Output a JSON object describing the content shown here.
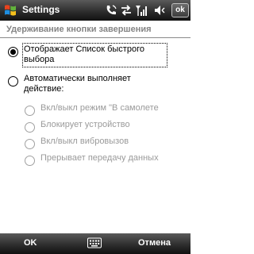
{
  "titlebar": {
    "title": "Settings",
    "ok_label": "ok",
    "icons": [
      "windows-start-icon",
      "phone-signal-icon",
      "sync-arrows-icon",
      "signal-strength-icon",
      "speaker-icon"
    ]
  },
  "page": {
    "heading": "Удерживание кнопки завершения"
  },
  "options": [
    {
      "label_line1": "Отображает Список быстрого",
      "label_line2": "выбора",
      "selected": true,
      "enabled": true
    },
    {
      "label_line1": "Автоматически выполняет",
      "label_line2": "действие:",
      "selected": false,
      "enabled": true
    },
    {
      "label": "Вкл/выкл режим \"В самолете",
      "selected": false,
      "enabled": false
    },
    {
      "label": "Блокирует устройство",
      "selected": false,
      "enabled": false
    },
    {
      "label": "Вкл/выкл вибровызов",
      "selected": false,
      "enabled": false
    },
    {
      "label": "Прерывает передачу данных",
      "selected": false,
      "enabled": false
    }
  ],
  "menubar": {
    "left_softkey": "OK",
    "right_softkey": "Отмена",
    "center_icon": "keyboard-icon"
  }
}
